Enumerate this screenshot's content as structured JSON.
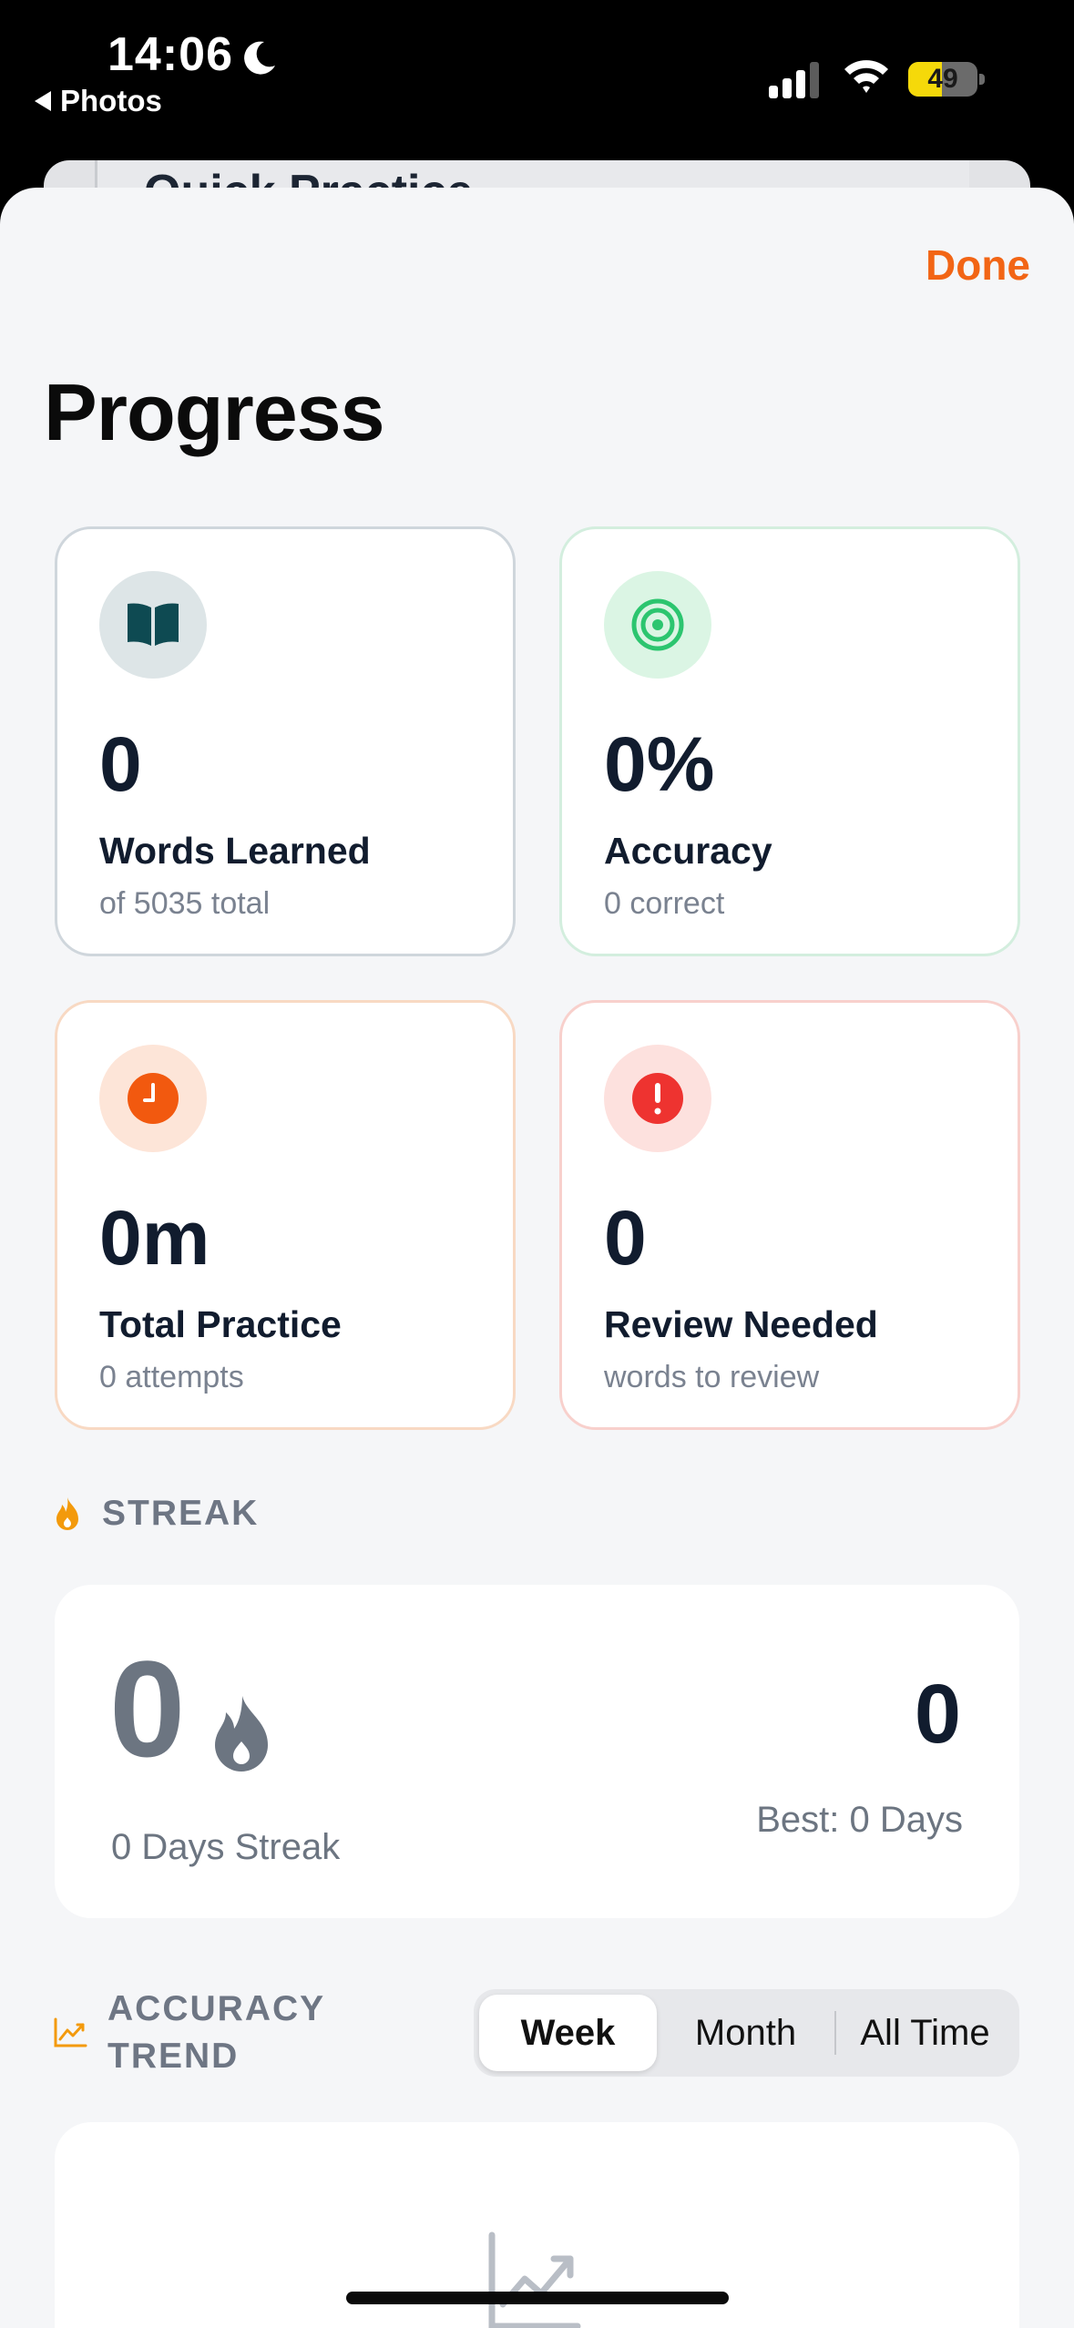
{
  "status_bar": {
    "time": "14:06",
    "back_label": "Photos",
    "battery_level": "49",
    "battery_fraction": 0.49
  },
  "background_sheet": {
    "title": "Quick Practice"
  },
  "header": {
    "done_label": "Done",
    "title": "Progress"
  },
  "stats": [
    {
      "icon": "book-icon",
      "value": "0",
      "label": "Words Learned",
      "sub": "of 5035 total",
      "accent": "#0e4a52",
      "bg": "#dde5e7"
    },
    {
      "icon": "target-icon",
      "value": "0%",
      "label": "Accuracy",
      "sub": "0 correct",
      "accent": "#2cc56f",
      "bg": "#dbf5e4"
    },
    {
      "icon": "clock-icon",
      "value": "0m",
      "label": "Total Practice",
      "sub": "0 attempts",
      "accent": "#f2590f",
      "bg": "#fde5d8"
    },
    {
      "icon": "alert-icon",
      "value": "0",
      "label": "Review Needed",
      "sub": "words to review",
      "accent": "#ee3330",
      "bg": "#fde1de"
    }
  ],
  "streak": {
    "section_title": "STREAK",
    "current": "0",
    "current_label": "0 Days Streak",
    "best": "0",
    "best_label": "Best: 0 Days"
  },
  "accuracy_trend": {
    "section_title_line1": "ACCURACY",
    "section_title_line2": "TREND",
    "segments": [
      "Week",
      "Month",
      "All Time"
    ],
    "selected": "Week"
  },
  "colors": {
    "accent": "#f26515",
    "streak_icon": "#f39a0c"
  }
}
